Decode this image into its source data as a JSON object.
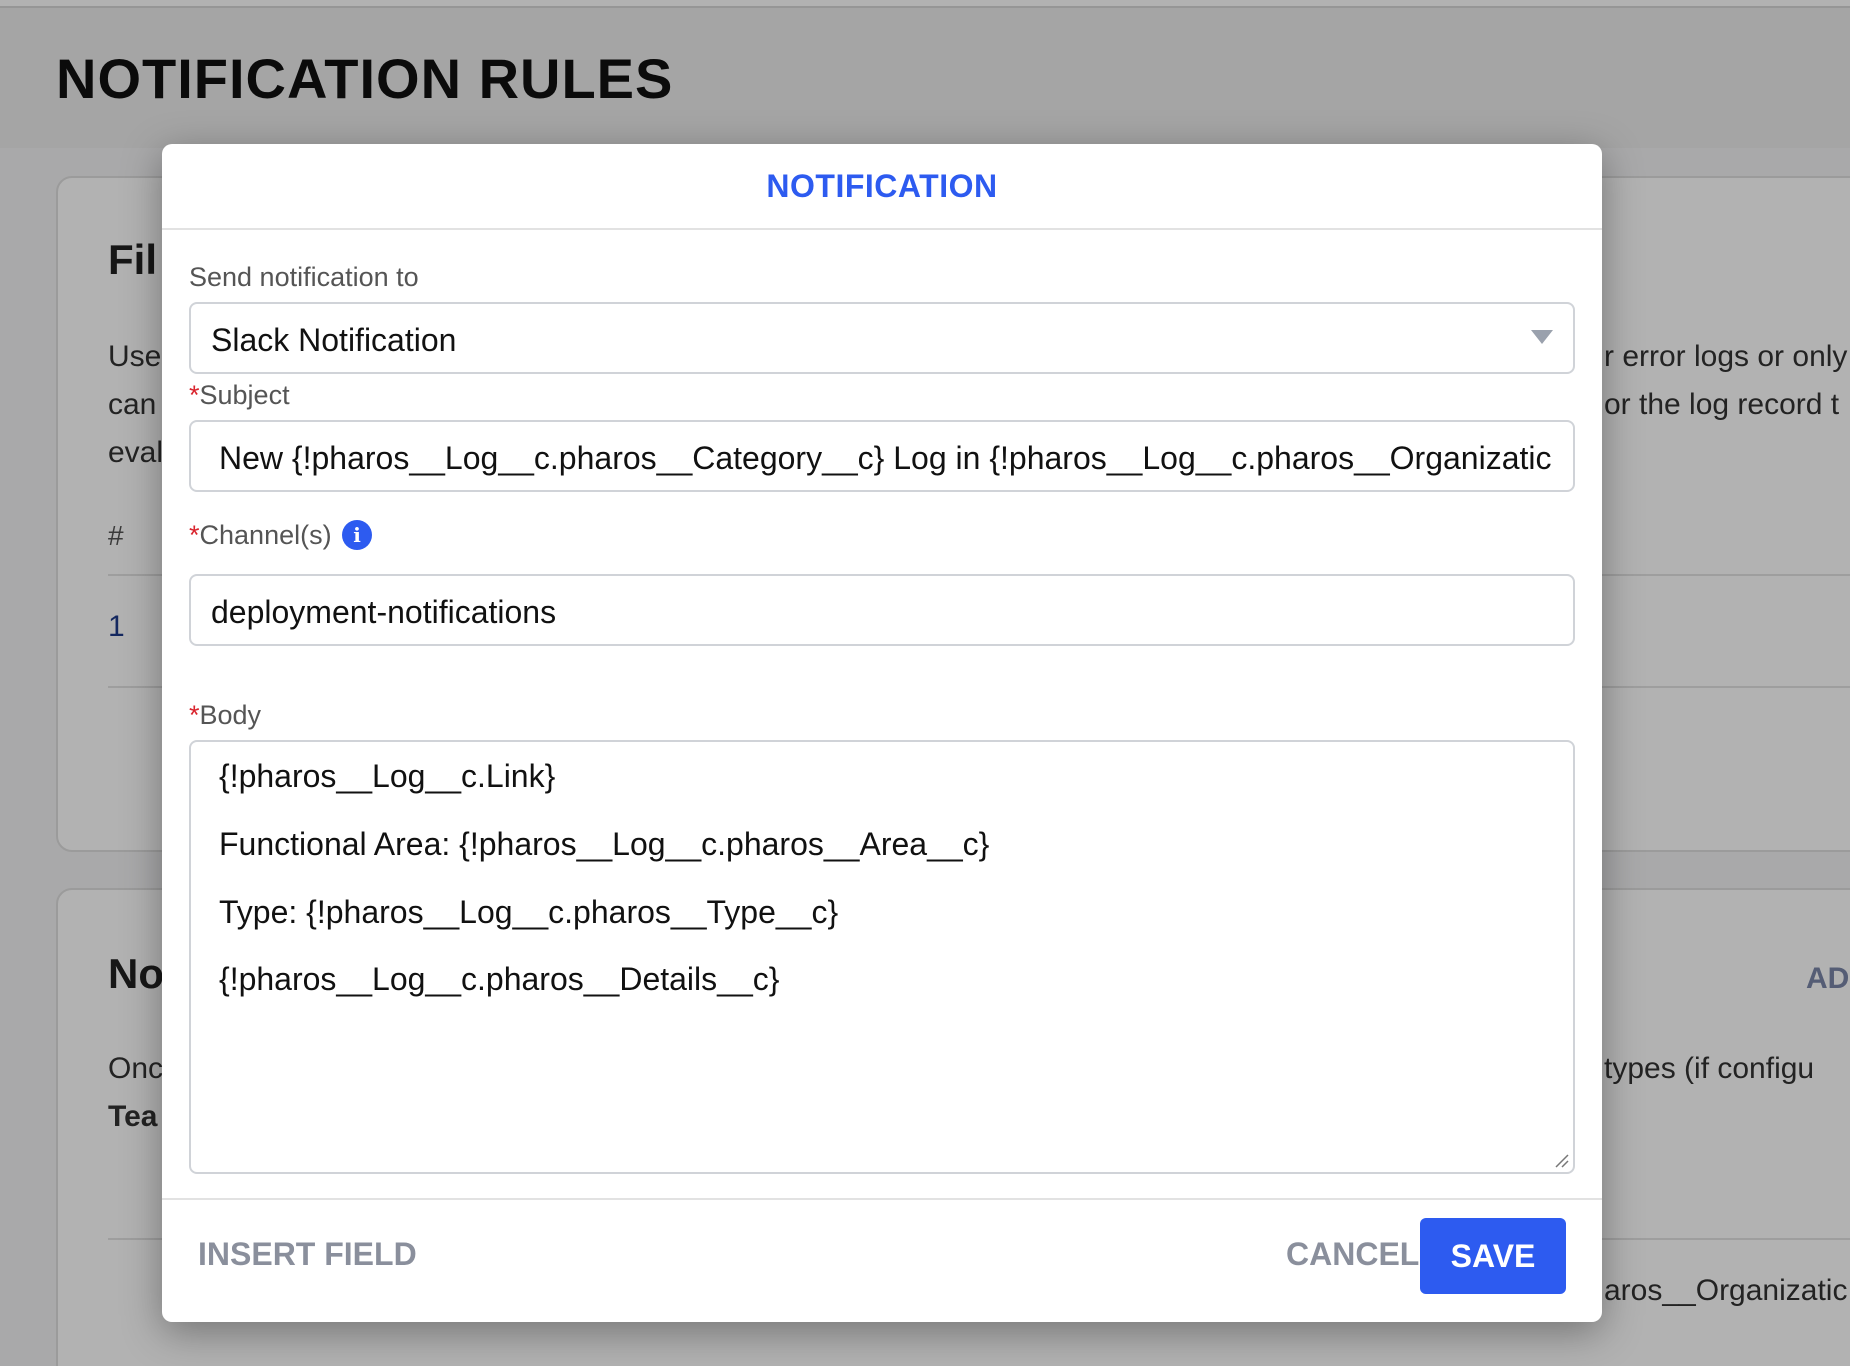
{
  "page": {
    "title": "NOTIFICATION RULES",
    "filter_card": {
      "heading": "Fil",
      "text_left": [
        "Use",
        "can",
        "eval"
      ],
      "text_right": [
        "r error logs or only",
        "or the log record t"
      ],
      "col_hash": "#",
      "row_number": "1"
    },
    "notification_card": {
      "heading": "No",
      "add_label": "AD",
      "text_left_1": "Onc",
      "text_left_2": "Tea",
      "text_right": "types (if configu",
      "row_text": "aros__Organizatic"
    }
  },
  "modal": {
    "title": "NOTIFICATION",
    "send_to": {
      "label": "Send notification to",
      "value": "Slack Notification"
    },
    "subject": {
      "required_mark": "*",
      "label": "Subject",
      "value": "New {!pharos__Log__c.pharos__Category__c} Log in {!pharos__Log__c.pharos__Organizatic"
    },
    "channels": {
      "required_mark": "*",
      "label": "Channel(s)",
      "info_icon": "i",
      "value": "deployment-notifications"
    },
    "body": {
      "required_mark": "*",
      "label": "Body",
      "lines": [
        "{!pharos__Log__c.Link}",
        "Functional Area: {!pharos__Log__c.pharos__Area__c}",
        "Type: {!pharos__Log__c.pharos__Type__c}",
        "{!pharos__Log__c.pharos__Details__c}"
      ]
    },
    "footer": {
      "insert_field": "INSERT FIELD",
      "cancel": "CANCEL",
      "save": "SAVE"
    }
  },
  "colors": {
    "accent": "#2d5bf0",
    "required": "#d9242d",
    "muted_button": "#8a8f9c"
  },
  "icons": [
    "info-icon",
    "chevron-down-icon",
    "resize-grip-icon"
  ]
}
